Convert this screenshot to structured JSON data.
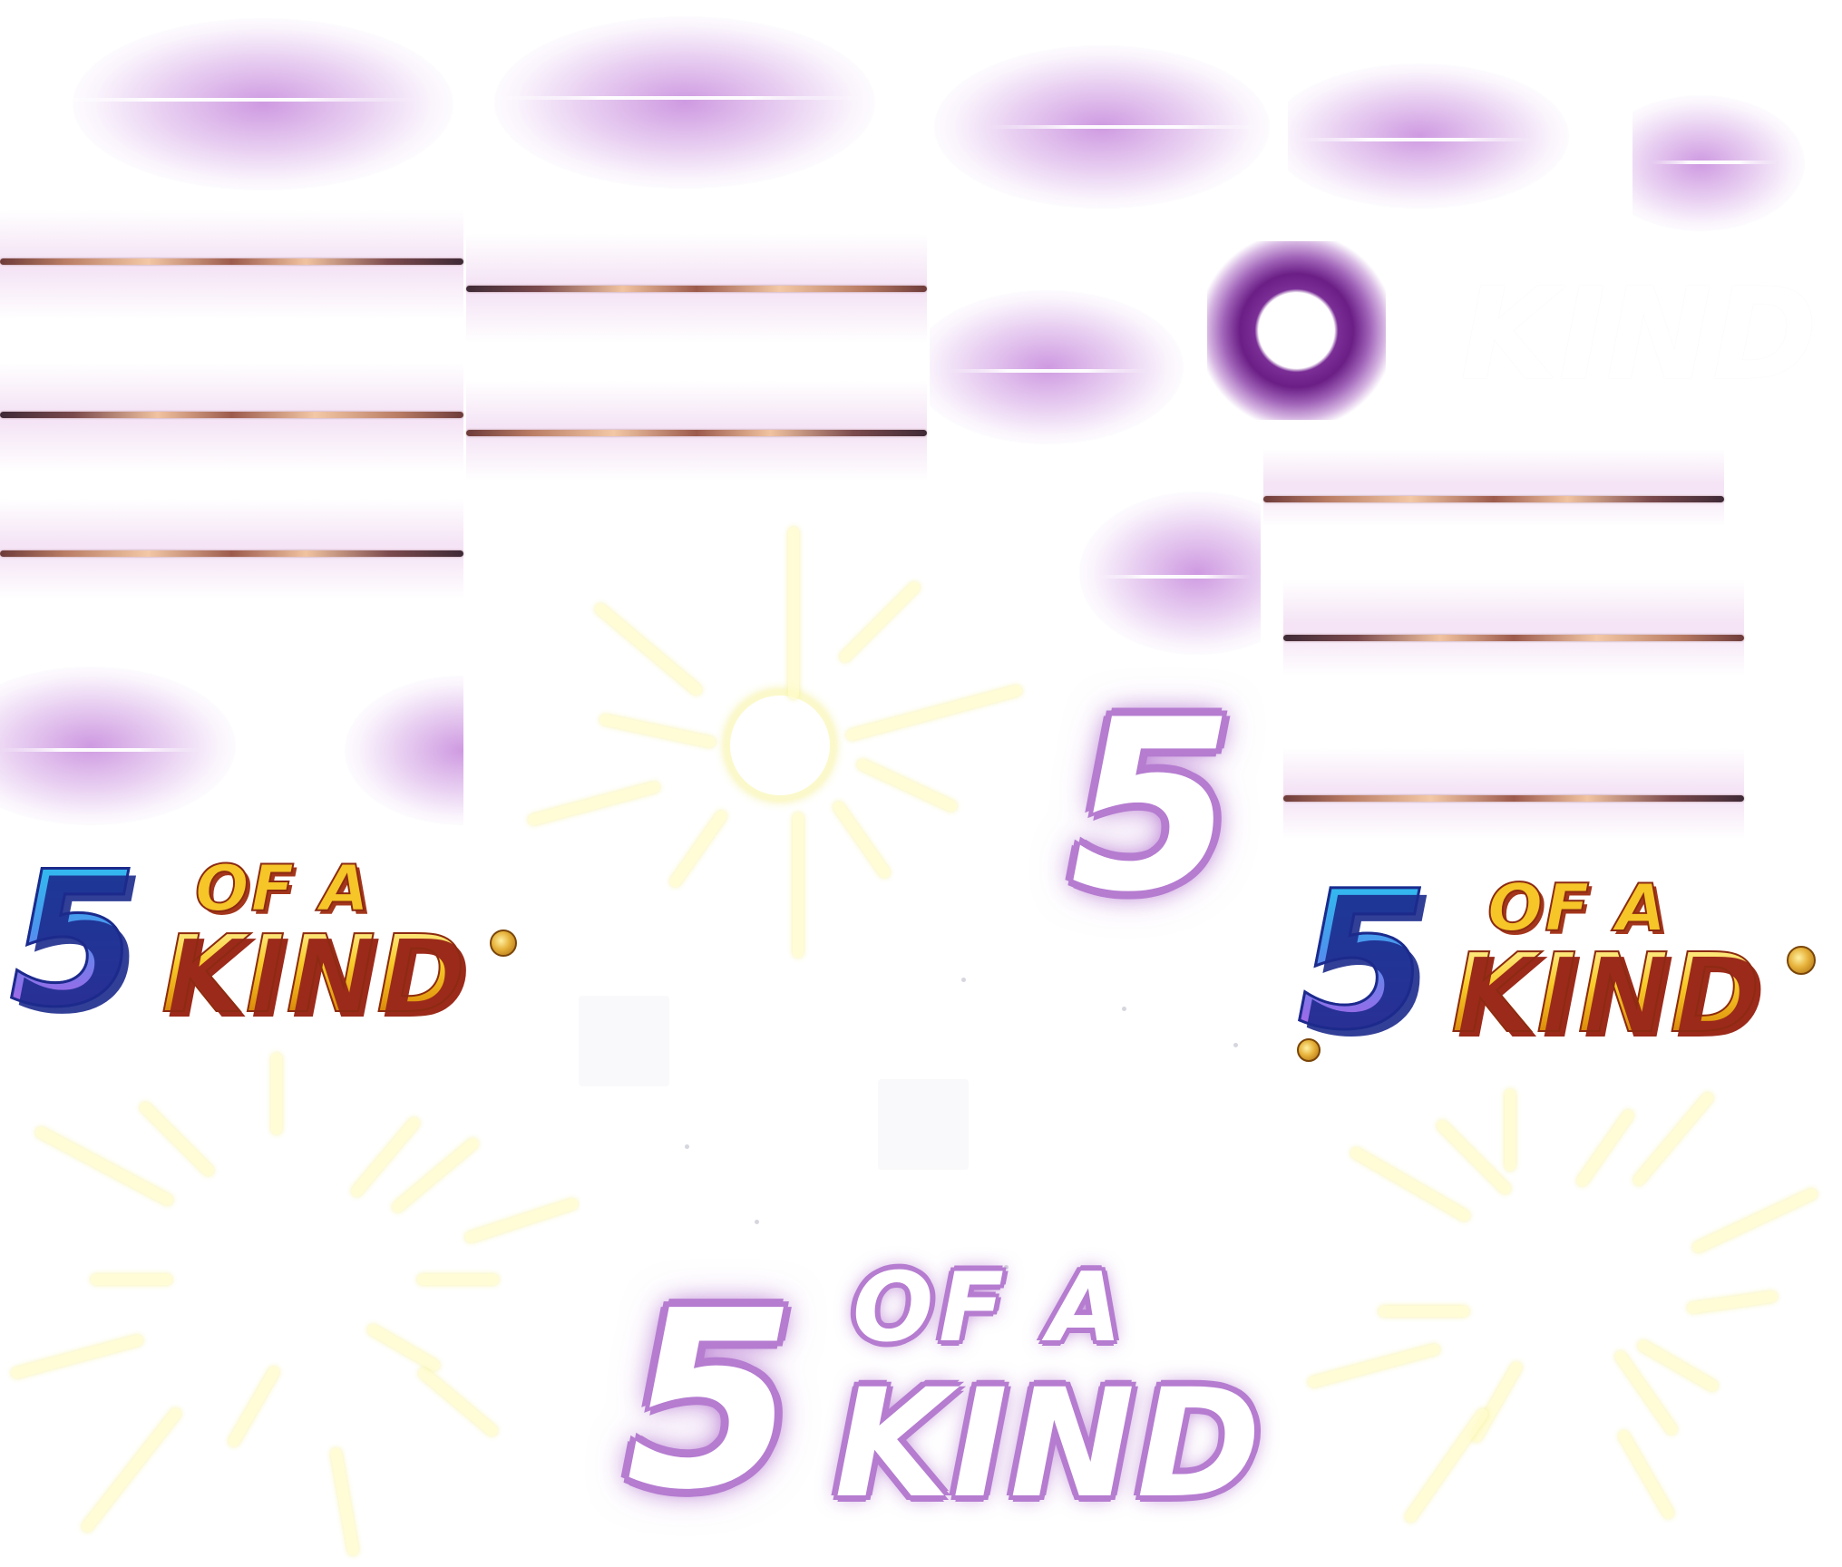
{
  "atlas": {
    "logo_color": {
      "five": "5",
      "of_a": "OF A",
      "kind": "KIND"
    },
    "logo_color_2": {
      "five": "5",
      "of_a": "OF A",
      "kind": "KIND"
    },
    "logo_white": {
      "five": "5",
      "of_a": "OF A",
      "kind": "KIND"
    },
    "digit_five": "5",
    "ghost_kind": "KIND",
    "colors": {
      "glow_purple": "#c48ad8",
      "ring_purple": "#6b1f86",
      "outline_purple": "#b57cd0",
      "ray_yellow": "#fffbc8",
      "gold": "#f8cc2a",
      "logo_blue": "#29c6ef"
    },
    "sprite_icons": [
      "purple-glow",
      "copper-streak",
      "purple-ring",
      "sunburst",
      "light-rays",
      "logo-5-of-a-kind",
      "logo-5-of-a-kind-white",
      "digit-5-white"
    ]
  }
}
